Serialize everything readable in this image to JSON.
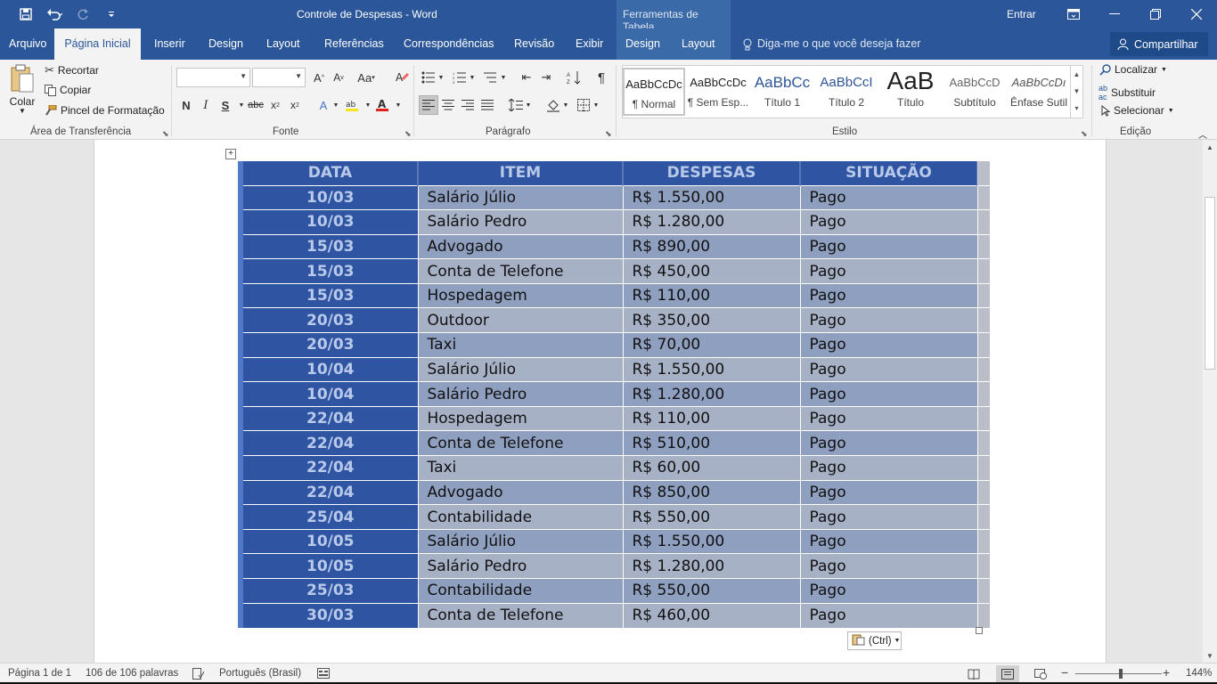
{
  "window": {
    "title": "Controle de Despesas  -  Word",
    "context_tools": "Ferramentas de Tabela",
    "signin": "Entrar"
  },
  "tabs": {
    "file": "Arquivo",
    "home": "Página Inicial",
    "insert": "Inserir",
    "design": "Design",
    "layout": "Layout",
    "references": "Referências",
    "mailings": "Correspondências",
    "review": "Revisão",
    "view": "Exibir",
    "table_design": "Design",
    "table_layout": "Layout",
    "tell_me": "Diga-me o que você deseja fazer",
    "share": "Compartilhar"
  },
  "ribbon": {
    "clipboard": {
      "label": "Área de Transferência",
      "paste": "Colar",
      "cut": "Recortar",
      "copy": "Copiar",
      "format_painter": "Pincel de Formatação"
    },
    "font": {
      "label": "Fonte",
      "font_name": "",
      "font_size": ""
    },
    "paragraph": {
      "label": "Parágrafo"
    },
    "styles": {
      "label": "Estilo",
      "items": [
        {
          "preview": "AaBbCcDc",
          "name": "¶ Normal"
        },
        {
          "preview": "AaBbCcDc",
          "name": "¶ Sem Esp..."
        },
        {
          "preview": "AaBbCc",
          "name": "Título 1"
        },
        {
          "preview": "AaBbCcI",
          "name": "Título 2"
        },
        {
          "preview": "AaB",
          "name": "Título"
        },
        {
          "preview": "AaBbCcD",
          "name": "Subtítulo"
        },
        {
          "preview": "AaBbCcDı",
          "name": "Ênfase Sutil"
        }
      ]
    },
    "editing": {
      "label": "Edição",
      "find": "Localizar",
      "replace": "Substituir",
      "select": "Selecionar"
    }
  },
  "table": {
    "headers": [
      "DATA",
      "ITEM",
      "DESPESAS",
      "SITUAÇÃO"
    ],
    "rows": [
      [
        "10/03",
        "Salário Júlio",
        "R$ 1.550,00",
        "Pago"
      ],
      [
        "10/03",
        "Salário Pedro",
        "R$ 1.280,00",
        "Pago"
      ],
      [
        "15/03",
        "Advogado",
        "R$ 890,00",
        "Pago"
      ],
      [
        "15/03",
        "Conta de Telefone",
        "R$ 450,00",
        "Pago"
      ],
      [
        "15/03",
        "Hospedagem",
        "R$ 110,00",
        "Pago"
      ],
      [
        "20/03",
        "Outdoor",
        "R$ 350,00",
        "Pago"
      ],
      [
        "20/03",
        "Taxi",
        "R$ 70,00",
        "Pago"
      ],
      [
        "10/04",
        "Salário Júlio",
        "R$ 1.550,00",
        "Pago"
      ],
      [
        "10/04",
        "Salário Pedro",
        "R$ 1.280,00",
        "Pago"
      ],
      [
        "22/04",
        "Hospedagem",
        "R$ 110,00",
        "Pago"
      ],
      [
        "22/04",
        "Conta de Telefone",
        "R$ 510,00",
        "Pago"
      ],
      [
        "22/04",
        "Taxi",
        "R$ 60,00",
        "Pago"
      ],
      [
        "22/04",
        "Advogado",
        "R$ 850,00",
        "Pago"
      ],
      [
        "25/04",
        "Contabilidade",
        "R$ 550,00",
        "Pago"
      ],
      [
        "10/05",
        "Salário Júlio",
        "R$ 1.550,00",
        "Pago"
      ],
      [
        "10/05",
        "Salário Pedro",
        "R$ 1.280,00",
        "Pago"
      ],
      [
        "25/03",
        "Contabilidade",
        "R$ 550,00",
        "Pago"
      ],
      [
        "30/03",
        "Conta de Telefone",
        "R$ 460,00",
        "Pago"
      ]
    ]
  },
  "paste_options": "(Ctrl)",
  "status": {
    "page": "Página 1 de 1",
    "words": "106 de 106 palavras",
    "language": "Português (Brasil)",
    "zoom": "144%"
  },
  "colors": {
    "title_bar": "#2b579a",
    "table_header": "#2f55a2",
    "row_odd": "#8f9fbf",
    "row_even": "#a7b1c6"
  }
}
